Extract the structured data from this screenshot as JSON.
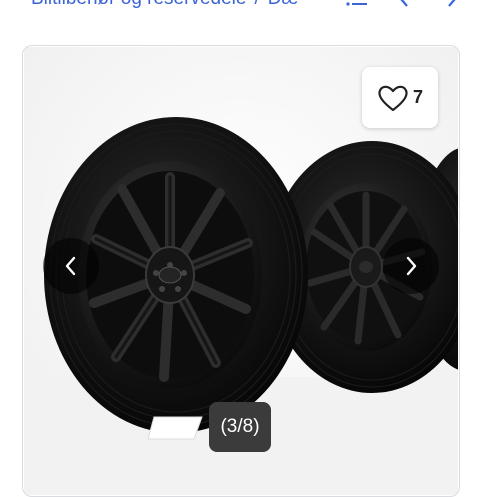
{
  "breadcrumb": {
    "items": [
      "Biltilbehør og reservedele",
      "Dæ"
    ],
    "separator": "/"
  },
  "toolbar": {
    "list_icon": "list-icon",
    "prev_icon": "chevron-left-icon",
    "next_icon": "chevron-right-icon"
  },
  "gallery": {
    "favorite_count": "7",
    "counter": "(3/8)",
    "image_alt": "black alloy wheels with tires"
  },
  "colors": {
    "link": "#3b64d6",
    "overlay": "#3b3b3b"
  }
}
